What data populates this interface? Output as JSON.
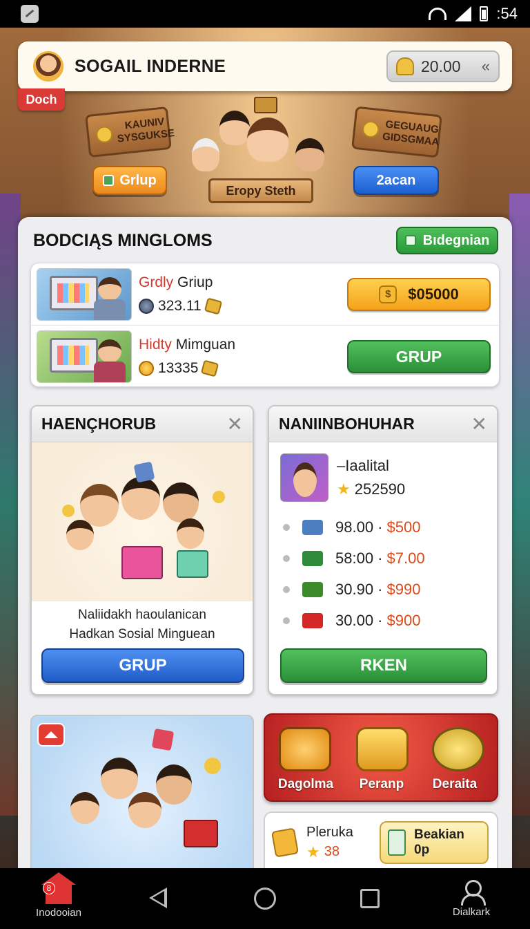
{
  "status_bar": {
    "time": ":54"
  },
  "header": {
    "title": "SOGAIL INDERNE",
    "coins": "20.00",
    "tag": "Doch"
  },
  "hero": {
    "sign_left": "KAUNIV SYSGUKSE",
    "sign_right": "GEGUAUG GIDSGMAA",
    "btn_left": "Grlup",
    "btn_right": "2acan",
    "banner": "Eropy Steth"
  },
  "section": {
    "title": "BODCIĄS MINGLOMS",
    "action": "Bıdegnian",
    "rows": [
      {
        "name_hi": "Grdly",
        "name_rest": " Griup",
        "value": "323.11",
        "button": "$05000"
      },
      {
        "name_hi": "Hidty",
        "name_rest": " Mimguan",
        "value": "13335",
        "button": "GRUP"
      }
    ]
  },
  "panel_left": {
    "title": "HAENÇHORUB",
    "caption_line1": "Naliidakh haoulanican",
    "caption_line2": "Hadkan Sosial Minguean",
    "button": "GRUP"
  },
  "panel_right": {
    "title": "NANIINBOHUHAR",
    "profile_name": "–Iaalital",
    "profile_score": "252590",
    "items": [
      {
        "price": "98.00",
        "alt": "$500",
        "color": "#4d7fc0"
      },
      {
        "price": "58:00",
        "alt": "$7.00",
        "color": "#2f8a3a"
      },
      {
        "price": "30.90",
        "alt": "$990",
        "color": "#3c8a2c"
      },
      {
        "price": "30.00",
        "alt": "$900",
        "color": "#d32626"
      }
    ],
    "button": "RKEN"
  },
  "red_banner": {
    "items": [
      "Dagolma",
      "Peranp",
      "Deraita"
    ]
  },
  "promo": {
    "label": "Pleruka",
    "value": "38",
    "button_line1": "Beakian",
    "button_line2": "0p"
  },
  "nav": {
    "home_label": "Inodooian",
    "home_badge": "8",
    "profile_label": "Dialkark"
  },
  "colors": {
    "accent_green": "#2b9a3a",
    "accent_blue": "#1f5cc8",
    "accent_gold": "#f5a21a",
    "accent_red": "#d23a30"
  }
}
